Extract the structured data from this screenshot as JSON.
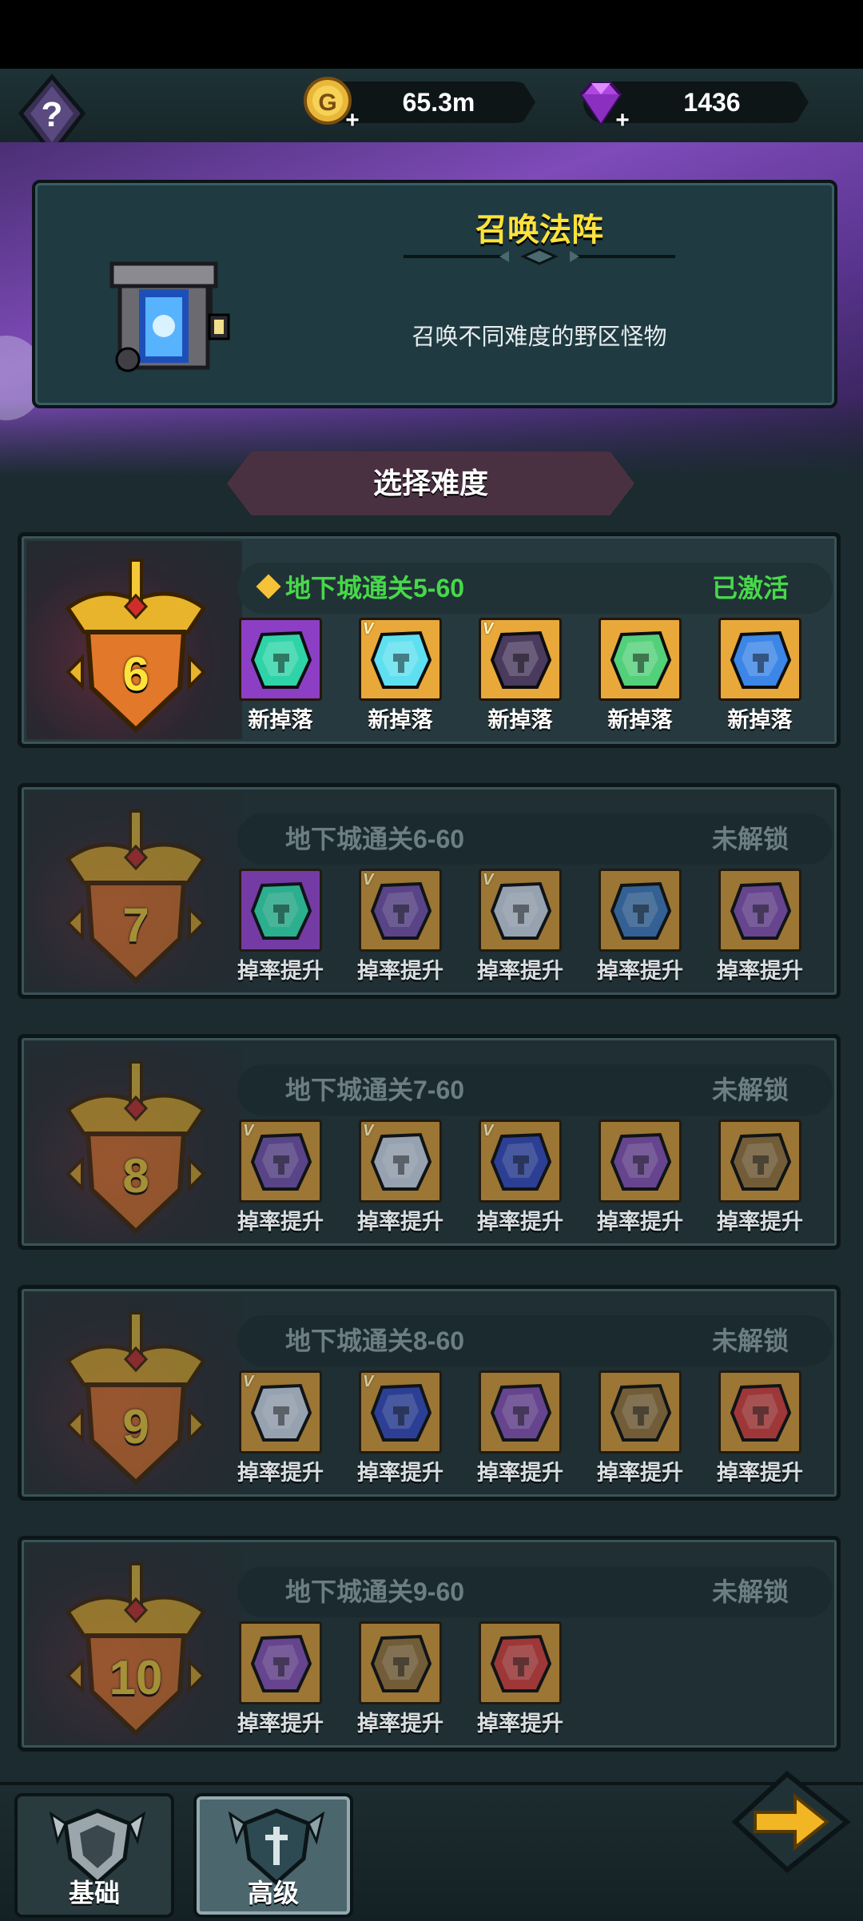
{
  "currency": {
    "gold": "65.3m",
    "gems": "1436"
  },
  "banner": {
    "title": "召唤法阵",
    "description": "召唤不同难度的野区怪物"
  },
  "section_title": "选择难度",
  "difficulties": [
    {
      "level": "6",
      "requirement": "地下城通关5-60",
      "status": "已激活",
      "active": true,
      "rewards": [
        {
          "bg": "#8c3fc4",
          "gem": "#2fd3a8",
          "v": "",
          "label": "新掉落"
        },
        {
          "bg": "#e8a93a",
          "gem": "#5fe0f0",
          "v": "V",
          "label": "新掉落"
        },
        {
          "bg": "#e8a93a",
          "gem": "#4a3a5e",
          "v": "V",
          "label": "新掉落"
        },
        {
          "bg": "#e8a93a",
          "gem": "#53d07a",
          "v": "",
          "label": "新掉落"
        },
        {
          "bg": "#e8a93a",
          "gem": "#3b86e6",
          "v": "",
          "label": "新掉落"
        }
      ]
    },
    {
      "level": "7",
      "requirement": "地下城通关6-60",
      "status": "未解锁",
      "active": false,
      "rewards": [
        {
          "bg": "#8c3fc4",
          "gem": "#2fd3a8",
          "v": "",
          "label": "掉率提升"
        },
        {
          "bg": "#c08a36",
          "gem": "#6b4aa0",
          "v": "V",
          "label": "掉率提升"
        },
        {
          "bg": "#c08a36",
          "gem": "#b9c3d3",
          "v": "V",
          "label": "掉率提升"
        },
        {
          "bg": "#c08a36",
          "gem": "#3a6fae",
          "v": "",
          "label": "掉率提升"
        },
        {
          "bg": "#c08a36",
          "gem": "#7a4aa8",
          "v": "",
          "label": "掉率提升"
        }
      ]
    },
    {
      "level": "8",
      "requirement": "地下城通关7-60",
      "status": "未解锁",
      "active": false,
      "rewards": [
        {
          "bg": "#c08a36",
          "gem": "#6b4aa0",
          "v": "V",
          "label": "掉率提升"
        },
        {
          "bg": "#c08a36",
          "gem": "#b9c3d3",
          "v": "V",
          "label": "掉率提升"
        },
        {
          "bg": "#c08a36",
          "gem": "#3044b0",
          "v": "V",
          "label": "掉率提升"
        },
        {
          "bg": "#c08a36",
          "gem": "#7a4aa8",
          "v": "",
          "label": "掉率提升"
        },
        {
          "bg": "#c08a36",
          "gem": "#8a6a3a",
          "v": "",
          "label": "掉率提升"
        }
      ]
    },
    {
      "level": "9",
      "requirement": "地下城通关8-60",
      "status": "未解锁",
      "active": false,
      "rewards": [
        {
          "bg": "#c08a36",
          "gem": "#b9c3d3",
          "v": "V",
          "label": "掉率提升"
        },
        {
          "bg": "#c08a36",
          "gem": "#3044b0",
          "v": "V",
          "label": "掉率提升"
        },
        {
          "bg": "#c08a36",
          "gem": "#7a4aa8",
          "v": "",
          "label": "掉率提升"
        },
        {
          "bg": "#c08a36",
          "gem": "#8a6a3a",
          "v": "",
          "label": "掉率提升"
        },
        {
          "bg": "#c08a36",
          "gem": "#c23a3a",
          "v": "",
          "label": "掉率提升"
        }
      ]
    },
    {
      "level": "10",
      "requirement": "地下城通关9-60",
      "status": "未解锁",
      "active": false,
      "rewards": [
        {
          "bg": "#c08a36",
          "gem": "#7a4aa8",
          "v": "",
          "label": "掉率提升"
        },
        {
          "bg": "#c08a36",
          "gem": "#8a6a3a",
          "v": "",
          "label": "掉率提升"
        },
        {
          "bg": "#c08a36",
          "gem": "#c23a3a",
          "v": "",
          "label": "掉率提升"
        }
      ]
    }
  ],
  "tabs": [
    {
      "label": "基础",
      "selected": false
    },
    {
      "label": "高级",
      "selected": true
    }
  ],
  "icons": {
    "help": "help-diamond-icon",
    "gold": "gold-coin-icon",
    "gem": "purple-gem-icon",
    "next": "arrow-right-icon"
  }
}
